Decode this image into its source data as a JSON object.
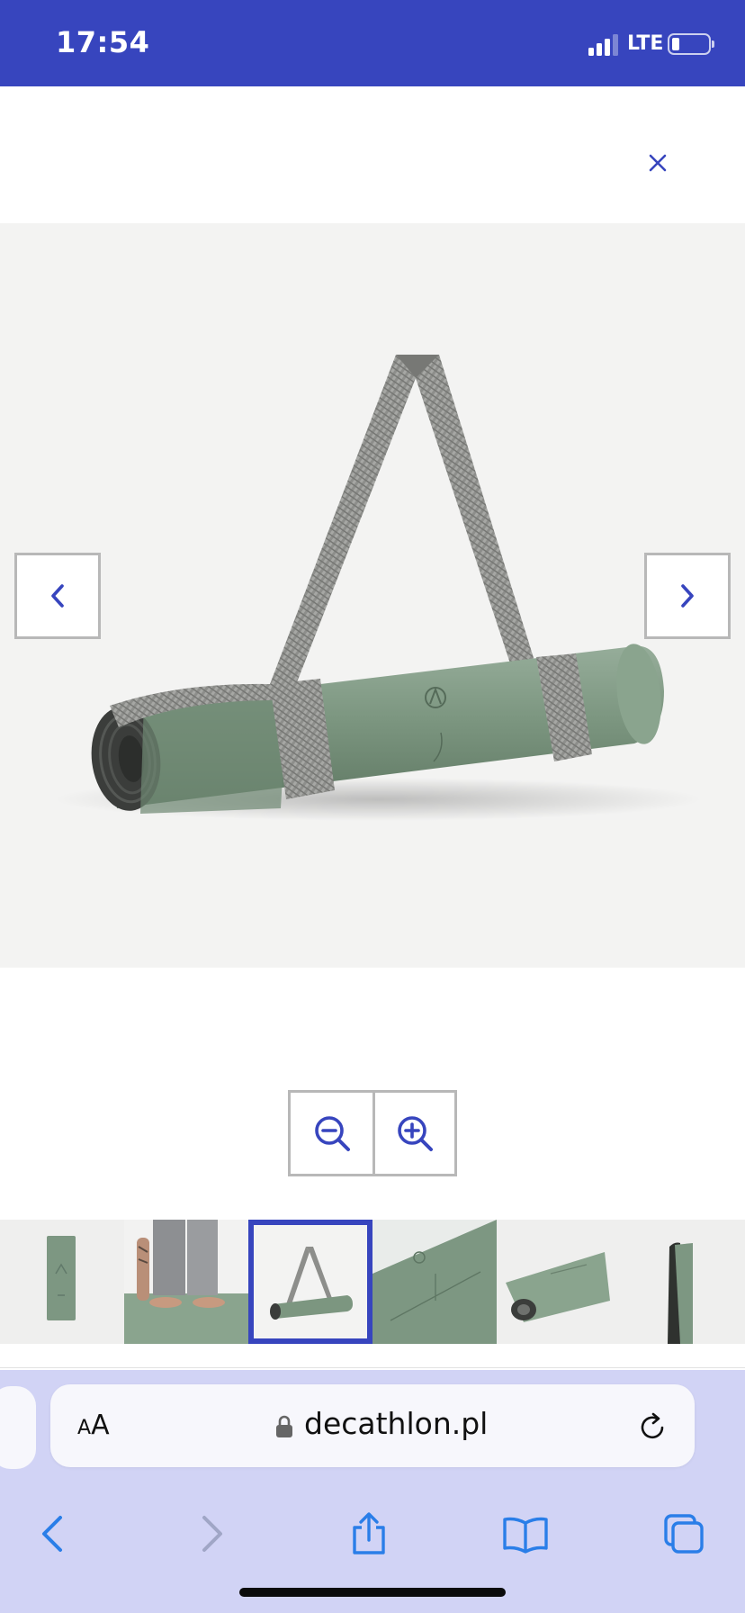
{
  "status_bar": {
    "time": "17:54",
    "network": "LTE",
    "signal_bars": 3,
    "battery_level": 0.15
  },
  "viewer": {
    "close_icon": "close-icon",
    "prev_icon": "chevron-left-icon",
    "next_icon": "chevron-right-icon",
    "zoom_out_icon": "zoom-out-icon",
    "zoom_in_icon": "zoom-in-icon",
    "selected_thumbnail_index": 2,
    "thumbnail_count": 6,
    "accent_color": "#3745be"
  },
  "browser": {
    "text_size_small": "A",
    "text_size_large": "A",
    "url": "decathlon.pl",
    "toolbar_icons": [
      "back-icon",
      "forward-icon",
      "share-icon",
      "bookmarks-icon",
      "tabs-icon"
    ],
    "bar_color": "#d1d3f5",
    "icon_color": "#2a7ee8"
  }
}
